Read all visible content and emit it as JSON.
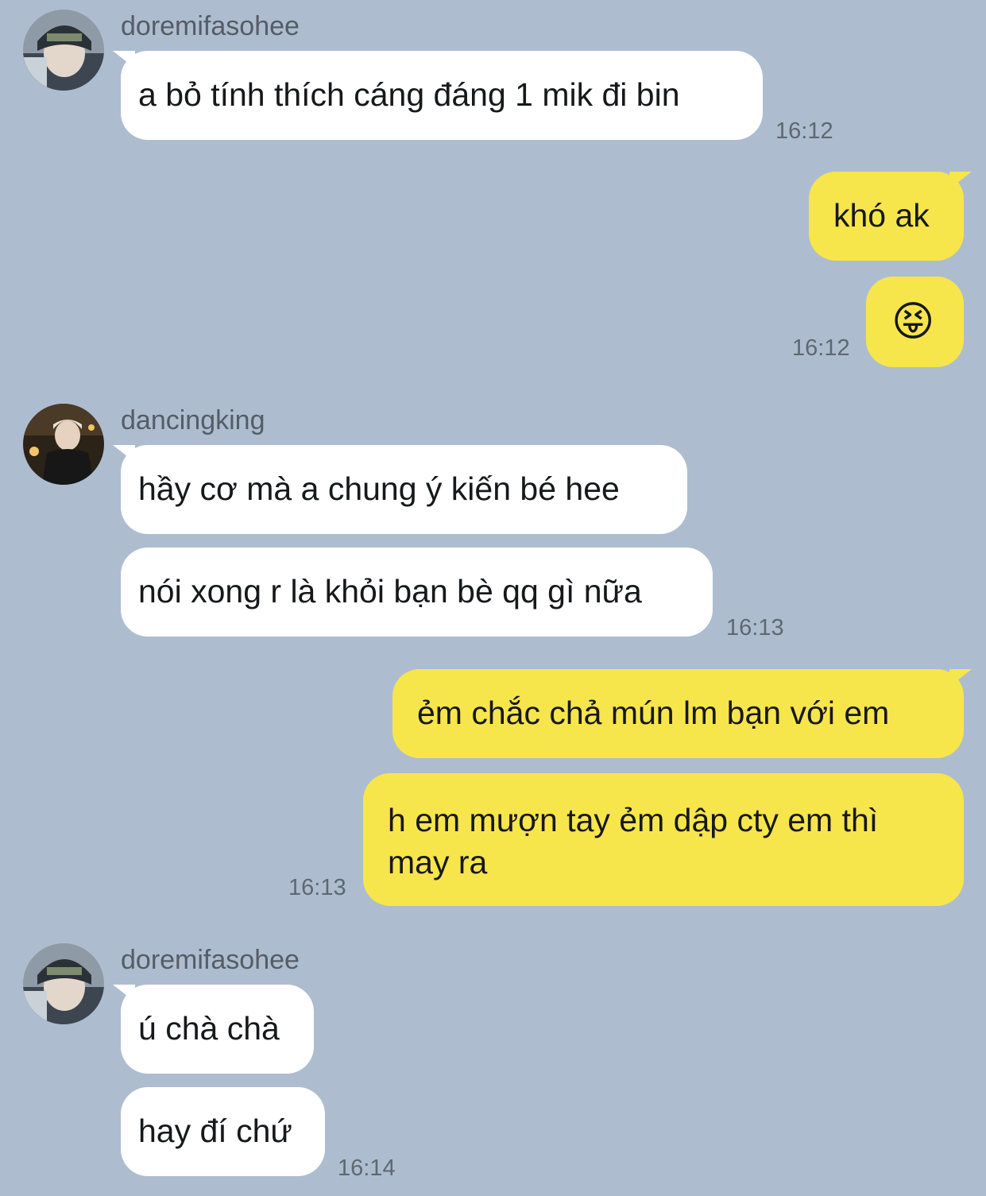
{
  "colors": {
    "background": "#adbdcf",
    "incoming_bubble": "#ffffff",
    "outgoing_bubble": "#f7e54c"
  },
  "messages": [
    {
      "sender": "doremifasohee",
      "avatar": "user-avatar-doremifasohee-icon",
      "text": "a bỏ tính thích cáng đáng 1 mik đi bin",
      "time": "16:12"
    },
    {
      "text": "khó ak"
    },
    {
      "emoji": "😝",
      "emoji_name": "squinting-face-with-tongue-icon",
      "time": "16:12"
    },
    {
      "sender": "dancingking",
      "avatar": "user-avatar-dancingking-icon",
      "text": "hầy cơ mà a chung ý kiến bé hee"
    },
    {
      "text": "nói xong r là khỏi bạn bè qq gì nữa",
      "time": "16:13"
    },
    {
      "text": "ẻm chắc chả mún lm bạn với em"
    },
    {
      "text": "h em mượn tay ẻm dập cty em thì may ra",
      "time": "16:13"
    },
    {
      "sender": "doremifasohee",
      "avatar": "user-avatar-doremifasohee-icon",
      "text": "ú chà chà"
    },
    {
      "text": "hay đí chứ",
      "time": "16:14"
    }
  ]
}
